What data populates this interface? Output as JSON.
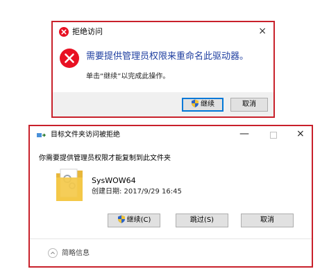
{
  "dialog1": {
    "title": "拒绝访问",
    "close": "×",
    "message": "需要提供管理员权限来重命名此驱动器。",
    "hint": "单击“继续”以完成此操作。",
    "buttons": {
      "continue": "继续",
      "cancel": "取消"
    }
  },
  "dialog2": {
    "title": "目标文件夹访问被拒绝",
    "controls": {
      "minimize": "—",
      "close": "×"
    },
    "message": "你需要提供管理员权限才能复制到此文件夹",
    "file": {
      "name": "SysWOW64",
      "created": "创建日期: 2017/9/29 16:45"
    },
    "buttons": {
      "continue": "继续(C)",
      "skip": "跳过(S)",
      "cancel": "取消"
    },
    "details": "简略信息"
  },
  "colors": {
    "error_red": "#e81123",
    "highlight_border": "#c8202a",
    "message_blue": "#1e3ea0",
    "folder_yellow": "#f4c94a"
  },
  "icons": [
    "error-icon",
    "shield-icon",
    "folder-icon",
    "chevron-up-icon",
    "copy-icon"
  ]
}
